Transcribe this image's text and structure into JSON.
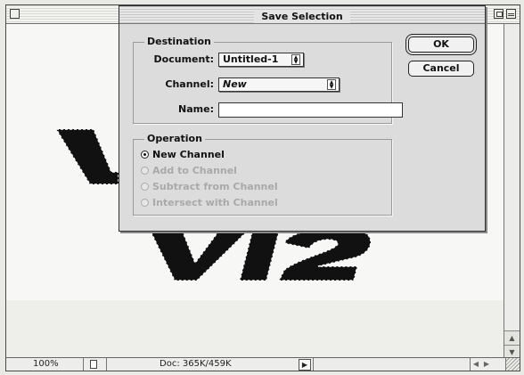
{
  "document": {
    "zoom": "100%",
    "doc_size": "Doc: 365K/459K",
    "artwork_text": "VI2"
  },
  "dialog": {
    "title": "Save Selection",
    "destination": {
      "group_label": "Destination",
      "document_label": "Document:",
      "document_value": "Untitled-1",
      "channel_label": "Channel:",
      "channel_value": "New",
      "name_label": "Name:",
      "name_value": ""
    },
    "operation": {
      "group_label": "Operation",
      "options": [
        {
          "label": "New Channel",
          "selected": true,
          "enabled": true
        },
        {
          "label": "Add to Channel",
          "selected": false,
          "enabled": false
        },
        {
          "label": "Subtract from Channel",
          "selected": false,
          "enabled": false
        },
        {
          "label": "Intersect with Channel",
          "selected": false,
          "enabled": false
        }
      ]
    },
    "buttons": {
      "ok": "OK",
      "cancel": "Cancel"
    }
  }
}
